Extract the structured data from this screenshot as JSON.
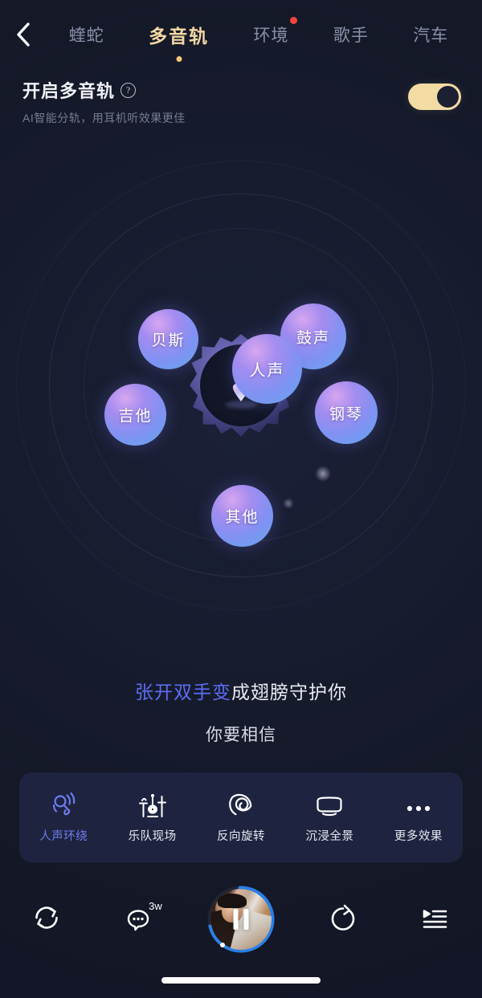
{
  "nav": {
    "back_icon": "chevron-left-icon",
    "tabs": [
      {
        "label": "蝰蛇",
        "active": false,
        "badge": false
      },
      {
        "label": "多音轨",
        "active": true,
        "badge": false
      },
      {
        "label": "环境",
        "active": false,
        "badge": true
      },
      {
        "label": "歌手",
        "active": false,
        "badge": false
      },
      {
        "label": "汽车",
        "active": false,
        "badge": false
      }
    ]
  },
  "header": {
    "title": "开启多音轨",
    "help_icon": "question-mark-icon",
    "help_glyph": "?",
    "subtitle": "AI智能分轨，用耳机听效果更佳",
    "toggle_state": "on",
    "toggle_color": "#F3DCA4"
  },
  "stage": {
    "center_icon": "person-avatar-icon",
    "tracks": [
      {
        "label": "贝斯",
        "name": "track-bubble-bass"
      },
      {
        "label": "鼓声",
        "name": "track-bubble-drums"
      },
      {
        "label": "人声",
        "name": "track-bubble-vocal"
      },
      {
        "label": "吉他",
        "name": "track-bubble-guitar"
      },
      {
        "label": "钢琴",
        "name": "track-bubble-piano"
      },
      {
        "label": "其他",
        "name": "track-bubble-other"
      }
    ]
  },
  "lyrics": {
    "line1_highlight": "张开双手变",
    "line1_rest": "成翅膀守护你",
    "line2": "你要相信",
    "highlight_color": "#5E6CF5"
  },
  "effects": {
    "items": [
      {
        "label": "人声环绕",
        "icon": "microphone-surround-icon",
        "active": true
      },
      {
        "label": "乐队现场",
        "icon": "drum-kit-icon",
        "active": false
      },
      {
        "label": "反向旋转",
        "icon": "spiral-icon",
        "active": false
      },
      {
        "label": "沉浸全景",
        "icon": "panorama-screen-icon",
        "active": false
      },
      {
        "label": "更多效果",
        "icon": "more-dots-icon",
        "active": false
      }
    ],
    "active_color": "#6F7CED"
  },
  "player": {
    "repeat_icon": "repeat-refresh-icon",
    "comment_icon": "comment-bubble-icon",
    "comment_count": "3w",
    "play_state": "playing",
    "pause_icon": "pause-icon",
    "progress_percent": 72,
    "progress_color": "#2A7FE8",
    "share_icon": "share-arrow-icon",
    "playlist_icon": "playlist-icon"
  }
}
